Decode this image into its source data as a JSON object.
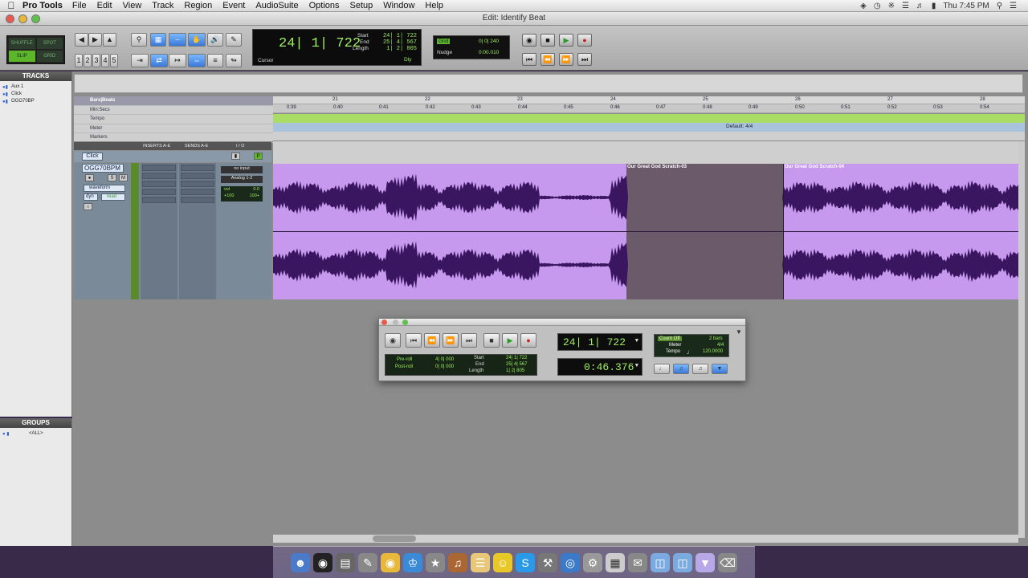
{
  "menubar": {
    "app": "Pro Tools",
    "items": [
      "File",
      "Edit",
      "View",
      "Track",
      "Region",
      "Event",
      "AudioSuite",
      "Options",
      "Setup",
      "Window",
      "Help"
    ],
    "clock": "Thu 7:45 PM"
  },
  "window": {
    "title": "Edit: Identify Beat"
  },
  "toolbar": {
    "modes": [
      "SHUFFLE",
      "SPOT",
      "SLIP",
      "GRID"
    ],
    "active_mode": "SLIP",
    "zoom_presets": [
      "1",
      "2",
      "3",
      "4",
      "5"
    ]
  },
  "main_counter": {
    "value": "24| 1| 722",
    "cursor_label": "Cursor",
    "start_label": "Start",
    "start_value": "24| 1| 722",
    "end_label": "End",
    "end_value": "25| 4| 567",
    "length_label": "Length",
    "length_value": "1| 2| 805",
    "dly": "Dly"
  },
  "grid": {
    "grid_label": "Grid",
    "grid_value": "0| 0| 240",
    "nudge_label": "Nudge",
    "nudge_value": "0:00.010"
  },
  "tracks_panel": {
    "header": "TRACKS",
    "tracks": [
      "Aux 1",
      "Click",
      "OGG70BP"
    ]
  },
  "groups_panel": {
    "header": "GROUPS",
    "groups": [
      "<ALL>"
    ]
  },
  "rulers": {
    "labels": [
      "Bars|Beats",
      "Min:Secs",
      "Tempo",
      "Meter",
      "Markers"
    ],
    "bars": [
      "21",
      "22",
      "23",
      "24",
      "25",
      "26",
      "27",
      "28"
    ],
    "mins": [
      "0:39",
      "0:40",
      "0:41",
      "0:42",
      "0:43",
      "0:44",
      "0:45",
      "0:46",
      "0:47",
      "0:48",
      "0:49",
      "0:50",
      "0:51",
      "0:52",
      "0:53",
      "0:54"
    ],
    "meter_default": "Default: 4/4"
  },
  "strip_header": {
    "inserts": "INSERTS A-E",
    "sends": "SENDS A-E",
    "io": "I / O"
  },
  "click_track": {
    "name": "Click",
    "io_p": "P"
  },
  "audio_track": {
    "name": "OGG70BPM",
    "view": "waveform",
    "auto": "read",
    "dyn": "dyn",
    "input": "no input",
    "output": "Analog 1-2",
    "vol_label": "vol",
    "vol_value": "0.0",
    "pan_left": "+100",
    "pan_right": "100+"
  },
  "regions": [
    {
      "name": "Our Great God Scratch-03"
    },
    {
      "name": "Our Great God Scratch-04"
    }
  ],
  "transport": {
    "main_counter": "24| 1| 722",
    "sub_counter": "0:46.376",
    "preroll_label": "Pre-roll",
    "preroll_value": "4| 0| 000",
    "postroll_label": "Post-roll",
    "postroll_value": "0| 0| 000",
    "start_label": "Start",
    "start_value": "24| 1| 722",
    "end_label": "End",
    "end_value": "25| 4| 567",
    "length_label": "Length",
    "length_value": "1| 2| 805",
    "countoff_label": "Count Off",
    "countoff_value": "2 bars",
    "meter_label": "Meter",
    "meter_value": "4/4",
    "tempo_label": "Tempo",
    "tempo_value": "120.0000"
  },
  "colors": {
    "region": "#c699ee",
    "selection": "#6a5a6a",
    "waveform": "#3a1560",
    "tempo_lane": "#aadd66",
    "lcd_text": "#9fef5f"
  }
}
